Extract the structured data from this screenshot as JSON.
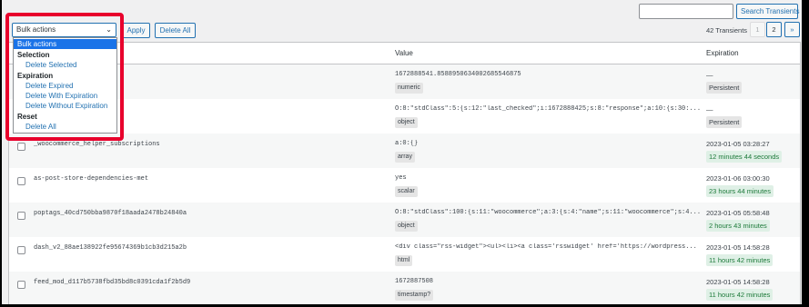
{
  "search": {
    "placeholder": "",
    "button": "Search Transients"
  },
  "tablenav": {
    "bulk_select": "Bulk actions",
    "apply": "Apply",
    "delete_all": "Delete All",
    "count": "42 Transients",
    "pages": {
      "current": "1",
      "next_page": "2",
      "next": "»"
    }
  },
  "dropdown": {
    "selected": "Bulk actions",
    "groups": [
      {
        "label": "Selection",
        "options": [
          "Delete Selected"
        ]
      },
      {
        "label": "Expiration",
        "options": [
          "Delete Expired",
          "Delete With Expiration",
          "Delete Without Expiration"
        ]
      },
      {
        "label": "Reset",
        "options": [
          "Delete All"
        ]
      }
    ]
  },
  "table": {
    "columns": {
      "value": "Value",
      "expiration": "Expiration"
    },
    "rows": [
      {
        "name": "",
        "value": "1672888541.8588950634002685546875",
        "type": "numeric",
        "expiration": "—",
        "badge": "Persistent",
        "badge_kind": "persist"
      },
      {
        "name": "",
        "value": "O:8:\"stdClass\":5:{s:12:\"last_checked\";i:1672888425;s:8:\"response\";a:10:{s:30:...",
        "type": "object",
        "expiration": "—",
        "badge": "Persistent",
        "badge_kind": "persist"
      },
      {
        "name": "_woocommerce_helper_subscriptions",
        "value": "a:0:{}",
        "type": "array",
        "expiration": "2023-01-05 03:28:27",
        "badge": "12 minutes 44 seconds",
        "badge_kind": "time"
      },
      {
        "name": "as-post-store-dependencies-met",
        "value": "yes",
        "type": "scalar",
        "expiration": "2023-01-06 03:00:30",
        "badge": "23 hours 44 minutes",
        "badge_kind": "time"
      },
      {
        "name": "poptags_40cd750bba9870f18aada2478b24840a",
        "value": "O:8:\"stdClass\":100:{s:11:\"woocommerce\";a:3:{s:4:\"name\";s:11:\"woocommerce\";s:4...",
        "type": "object",
        "expiration": "2023-01-05 05:58:48",
        "badge": "2 hours 43 minutes",
        "badge_kind": "time"
      },
      {
        "name": "dash_v2_88ae138922fe95674369b1cb3d215a2b",
        "value": "<div class=\"rss-widget\"><ul><li><a class='rsswidget' href='https://wordpress...",
        "type": "html",
        "expiration": "2023-01-05 14:58:28",
        "badge": "11 hours 42 minutes",
        "badge_kind": "time"
      },
      {
        "name": "feed_mod_d117b5738fbd35bd8c0391cda1f2b5d9",
        "value": "1672887508",
        "type": "timestamp?",
        "expiration": "2023-01-05 14:58:28",
        "badge": "11 hours 42 minutes",
        "badge_kind": "time"
      }
    ]
  }
}
